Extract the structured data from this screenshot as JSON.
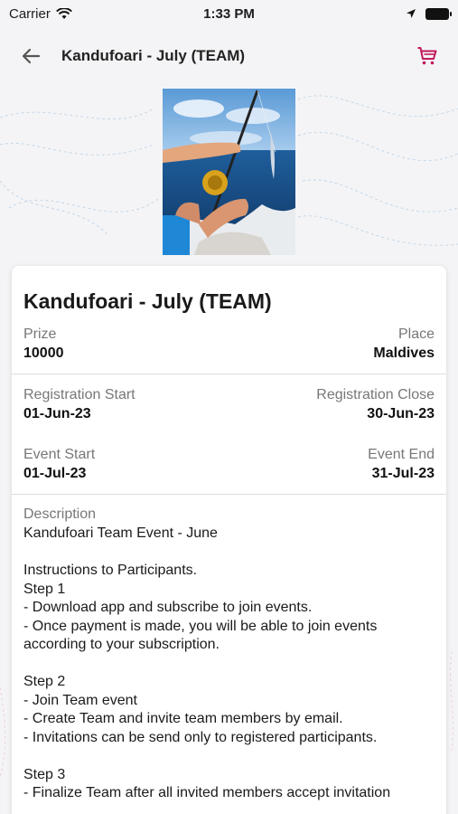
{
  "status_bar": {
    "carrier": "Carrier",
    "time": "1:33 PM"
  },
  "nav": {
    "title": "Kandufoari - July (TEAM)",
    "back_icon": "arrow-left-icon",
    "cart_icon": "cart-icon",
    "accent_color": "#c2185b"
  },
  "event": {
    "title": "Kandufoari - July (TEAM)",
    "prize_label": "Prize",
    "prize_value": "10000",
    "place_label": "Place",
    "place_value": "Maldives",
    "reg_start_label": "Registration Start",
    "reg_start_value": "01-Jun-23",
    "reg_close_label": "Registration Close",
    "reg_close_value": "30-Jun-23",
    "event_start_label": "Event Start",
    "event_start_value": "01-Jul-23",
    "event_end_label": "Event End",
    "event_end_value": "31-Jul-23",
    "description_label": "Description",
    "description_text": "Kandufoari Team Event - June\n\nInstructions to Participants.\nStep 1\n- Download app and subscribe to join events.\n- Once payment is made, you will be able to join events according to your subscription.\n\nStep 2\n- Join Team event\n- Create Team and invite team members by email.\n- Invitations can be send only to registered participants.\n\nStep 3\n- Finalize Team after all invited members accept invitation"
  }
}
